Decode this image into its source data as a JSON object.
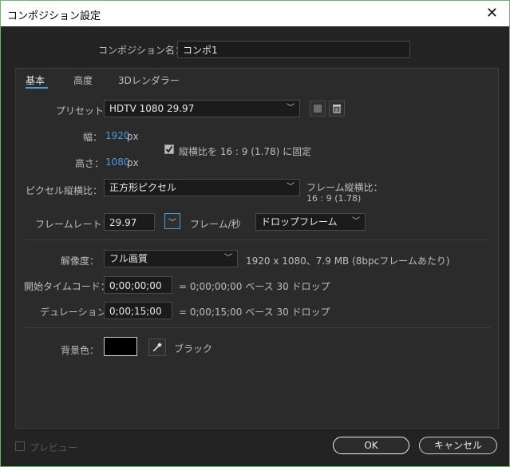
{
  "window": {
    "title": "コンポジション設定"
  },
  "name": {
    "label": "コンポジション名：",
    "value": "コンポ1"
  },
  "tabs": [
    {
      "label": "基本"
    },
    {
      "label": "高度"
    },
    {
      "label": "3Dレンダラー"
    }
  ],
  "preset": {
    "label": "プリセット：",
    "value": "HDTV 1080 29.97"
  },
  "width": {
    "label": "幅：",
    "value": "1920",
    "unit": "px"
  },
  "height": {
    "label": "高さ：",
    "value": "1080",
    "unit": "px"
  },
  "lock_aspect": {
    "label": "縦横比を 16 : 9 (1.78) に固定",
    "checked": true
  },
  "pixel_aspect": {
    "label": "ピクセル縦横比：",
    "value": "正方形ピクセル"
  },
  "frame_aspect": {
    "label": "フレーム縦横比：",
    "value": "16 : 9 (1.78)"
  },
  "frame_rate": {
    "label": "フレームレート：",
    "value": "29.97",
    "unit": "フレーム/秒",
    "drop": "ドロップフレーム"
  },
  "resolution": {
    "label": "解像度：",
    "value": "フル画質",
    "info": "1920 x 1080、7.9 MB (8bpcフレームあたり)"
  },
  "start_tc": {
    "label": "開始タイムコード：",
    "value": "0;00;00;00",
    "note": "= 0;00;00;00 ベース 30 ドロップ"
  },
  "duration": {
    "label": "デュレーション：",
    "value": "0;00;15;00",
    "note": "= 0;00;15;00 ベース 30 ドロップ"
  },
  "bg": {
    "label": "背景色：",
    "color": "#000000",
    "name": "ブラック"
  },
  "preview": {
    "label": "プレビュー"
  },
  "buttons": {
    "ok": "OK",
    "cancel": "キャンセル"
  },
  "colors": {
    "accent": "#4a9be0",
    "panel": "#2b2b2b",
    "frame": "#232323"
  }
}
